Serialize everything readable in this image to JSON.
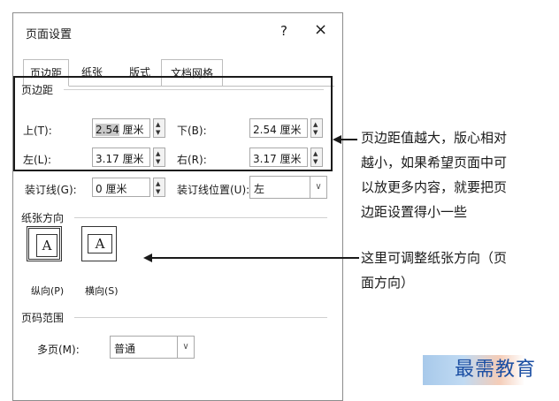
{
  "dialog": {
    "title": "页面设置",
    "help": "?",
    "close": "×",
    "tabs": [
      "页边距",
      "纸张",
      "版式",
      "文档网格"
    ],
    "margins": {
      "section": "页边距",
      "top_label": "上(T):",
      "top_value": "2.54",
      "bottom_label": "下(B):",
      "bottom_value": "2.54 厘米",
      "left_label": "左(L):",
      "left_value": "3.17 厘米",
      "right_label": "右(R):",
      "right_value": "3.17 厘米",
      "unit": "厘米",
      "gutter_label": "装订线(G):",
      "gutter_value": "0 厘米",
      "gutter_pos_label": "装订线位置(U):",
      "gutter_pos_value": "左"
    },
    "orientation": {
      "section": "纸张方向",
      "glyph": "A",
      "portrait": "纵向(P)",
      "landscape": "横向(S)"
    },
    "pages": {
      "section": "页码范围",
      "multi_label": "多页(M):",
      "multi_value": "普通"
    }
  },
  "annotations": {
    "note1": [
      "页边距值越大，版心相对",
      "越小，如果希望页面中可",
      "以放更多内容，就要把页",
      "边距设置得小一些"
    ],
    "note2": [
      "这里可调整纸张方向（页",
      "面方向）"
    ]
  },
  "watermark": "最需教育"
}
